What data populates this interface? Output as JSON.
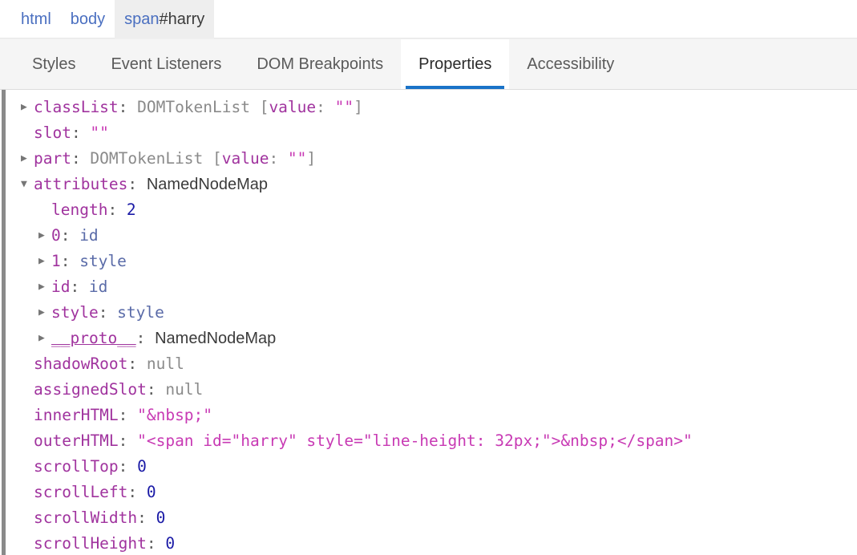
{
  "breadcrumb": {
    "items": [
      {
        "name": "crumb-html",
        "tag": "html",
        "id": "",
        "selected": false
      },
      {
        "name": "crumb-body",
        "tag": "body",
        "id": "",
        "selected": false
      },
      {
        "name": "crumb-span-harry",
        "tag": "span",
        "id": "#harry",
        "selected": true
      }
    ]
  },
  "tabs": [
    {
      "label": "Styles",
      "active": false
    },
    {
      "label": "Event Listeners",
      "active": false
    },
    {
      "label": "DOM Breakpoints",
      "active": false
    },
    {
      "label": "Properties",
      "active": true
    },
    {
      "label": "Accessibility",
      "active": false
    }
  ],
  "colors": {
    "accent": "#1a73c8",
    "property_name": "#a0339e",
    "string_value": "#c83ab4",
    "number_value": "#1a1aa6",
    "object_value": "#5a6ba8",
    "type_name": "#8a8a8a",
    "tab_bar_bg": "#f5f5f5",
    "selected_crumb_bg": "#eeeeee"
  },
  "properties": [
    {
      "name": "classList",
      "level": 0,
      "expander": "collapsed",
      "value_kind": "domtokenlist",
      "type_text": "DOMTokenList",
      "bracket_key": "value",
      "bracket_value": "\"\""
    },
    {
      "name": "slot",
      "level": 0,
      "expander": "none",
      "value_kind": "string",
      "value_text": "\"\""
    },
    {
      "name": "part",
      "level": 0,
      "expander": "collapsed",
      "value_kind": "domtokenlist",
      "type_text": "DOMTokenList",
      "bracket_key": "value",
      "bracket_value": "\"\""
    },
    {
      "name": "attributes",
      "level": 0,
      "expander": "expanded",
      "value_kind": "type_prop",
      "value_text": "NamedNodeMap"
    },
    {
      "name": "length",
      "level": 1,
      "expander": "none",
      "value_kind": "number",
      "value_text": "2"
    },
    {
      "name": "0",
      "level": 1,
      "expander": "collapsed",
      "value_kind": "object",
      "value_text": "id"
    },
    {
      "name": "1",
      "level": 1,
      "expander": "collapsed",
      "value_kind": "object",
      "value_text": "style"
    },
    {
      "name": "id",
      "level": 1,
      "expander": "collapsed",
      "value_kind": "object",
      "value_text": "id"
    },
    {
      "name": "style",
      "level": 1,
      "expander": "collapsed",
      "value_kind": "object",
      "value_text": "style"
    },
    {
      "name": "__proto__",
      "level": 1,
      "expander": "collapsed",
      "value_kind": "type_prop",
      "value_text": "NamedNodeMap",
      "is_proto": true
    },
    {
      "name": "shadowRoot",
      "level": 0,
      "expander": "none",
      "value_kind": "null",
      "value_text": "null"
    },
    {
      "name": "assignedSlot",
      "level": 0,
      "expander": "none",
      "value_kind": "null",
      "value_text": "null"
    },
    {
      "name": "innerHTML",
      "level": 0,
      "expander": "none",
      "value_kind": "string",
      "value_text": "\"&nbsp;\""
    },
    {
      "name": "outerHTML",
      "level": 0,
      "expander": "none",
      "value_kind": "string",
      "value_text": "\"<span id=\"harry\" style=\"line-height: 32px;\">&nbsp;</span>\""
    },
    {
      "name": "scrollTop",
      "level": 0,
      "expander": "none",
      "value_kind": "number",
      "value_text": "0"
    },
    {
      "name": "scrollLeft",
      "level": 0,
      "expander": "none",
      "value_kind": "number",
      "value_text": "0"
    },
    {
      "name": "scrollWidth",
      "level": 0,
      "expander": "none",
      "value_kind": "number",
      "value_text": "0"
    },
    {
      "name": "scrollHeight",
      "level": 0,
      "expander": "none",
      "value_kind": "number",
      "value_text": "0"
    }
  ],
  "icons": {
    "collapsed": "▶",
    "expanded": "▼"
  }
}
